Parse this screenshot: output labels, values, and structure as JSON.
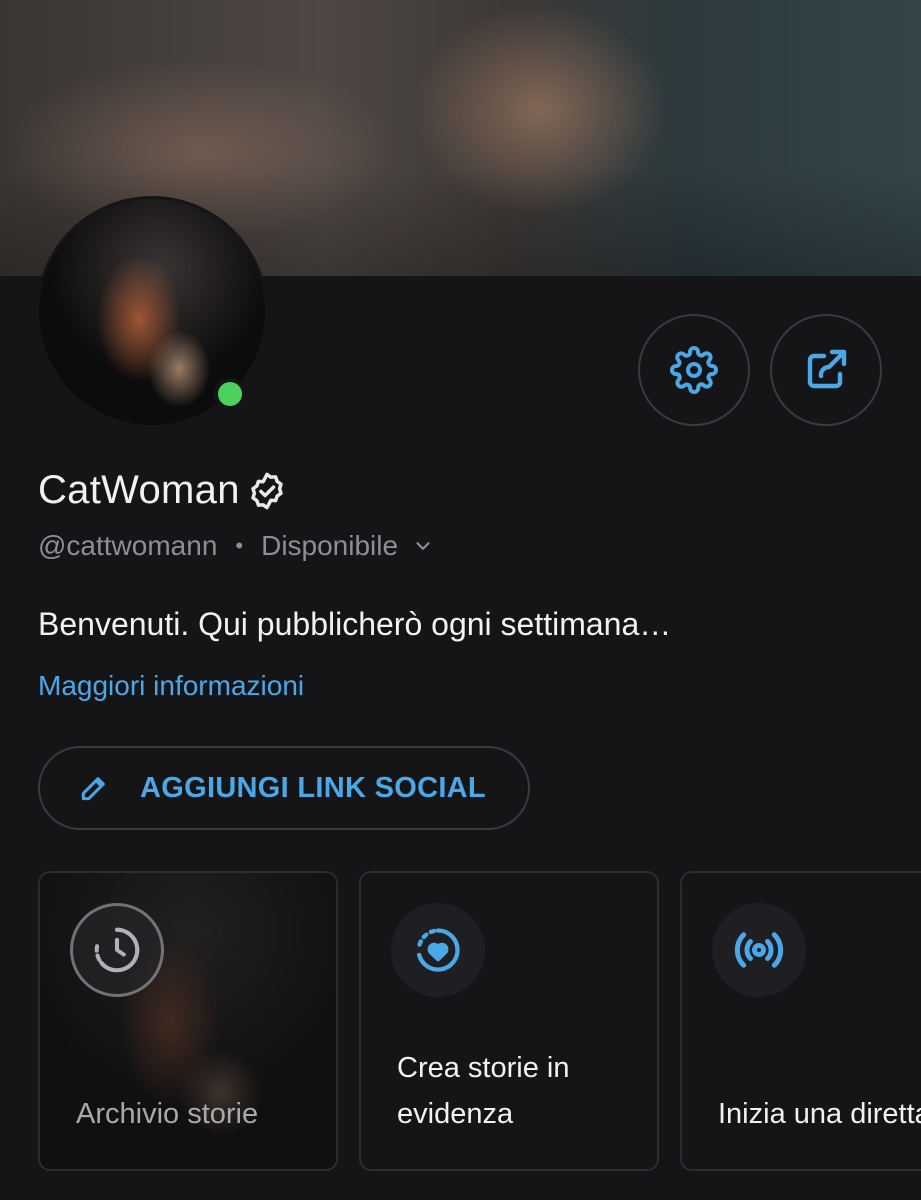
{
  "profile": {
    "name": "CatWoman",
    "handle": "@cattwomann",
    "separator": "•",
    "status": "Disponibile",
    "bio": "Benvenuti. Qui pubblicherò ogni settimana…",
    "more_info": "Maggiori informazioni",
    "online": true
  },
  "actions": {
    "add_social": "AGGIUNGI LINK SOCIAL"
  },
  "cards": [
    {
      "label": "Archivio storie",
      "icon": "story-archive-clock-icon"
    },
    {
      "label": "Crea storie in evidenza",
      "icon": "highlight-heart-icon"
    },
    {
      "label": "Inizia una diretta",
      "icon": "live-broadcast-icon"
    }
  ],
  "icons": {
    "settings": "gear-icon",
    "share": "share-icon",
    "verified": "verified-badge-icon",
    "edit": "pencil-icon",
    "dropdown": "chevron-down-icon"
  },
  "colors": {
    "background": "#151518",
    "accent": "#4aa8e8",
    "online": "#4cd05e",
    "muted_text": "#8e8e93"
  }
}
